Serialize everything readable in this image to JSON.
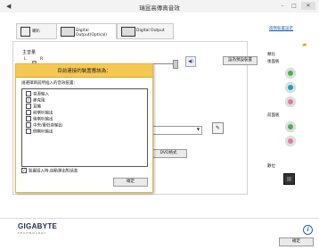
{
  "window": {
    "title": "瑞昱高傳真音效",
    "minimize": "–",
    "maximize": "□",
    "close": "✕"
  },
  "tabs": [
    {
      "label": "喇叭"
    },
    {
      "label": "Digital Output(Optical)"
    },
    {
      "label": "Digital Output"
    }
  ],
  "advanced_link": "進階裝置設定",
  "main_volume": {
    "label": "主音量",
    "left": "L",
    "right": "R",
    "default_device_button": "設為預設裝置"
  },
  "format_button": "DVD格式",
  "side_panel": {
    "rear_label": "後面板",
    "front_label": "前面板",
    "analog_label": "類比",
    "digital_label": "數位"
  },
  "colors": {
    "accent": "#f5c851",
    "jack_green": "#4caf50",
    "jack_teal": "#17a6b8",
    "jack_pink": "#e37b99"
  },
  "dialog": {
    "title": "目前連接的裝置應該為：",
    "prompt": "請選擇目前所插入的音效裝置：",
    "options": [
      {
        "label": "音源輸入",
        "checked": false
      },
      {
        "label": "麥克風",
        "checked": true
      },
      {
        "label": "耳機",
        "checked": false
      },
      {
        "label": "前喇叭輸出",
        "checked": false
      },
      {
        "label": "後喇叭輸出",
        "checked": false
      },
      {
        "label": "中央/重低音輸出",
        "checked": false
      },
      {
        "label": "側喇叭輸出",
        "checked": false
      }
    ],
    "auto_popup_label": "裝置插入時,自動彈出對話盒",
    "auto_popup_checked": true,
    "ok_button": "確定"
  },
  "footer": {
    "brand": "GIGABYTE",
    "brand_sub": "TECHNOLOGY",
    "ok_button": "確定",
    "info_icon": "i"
  }
}
